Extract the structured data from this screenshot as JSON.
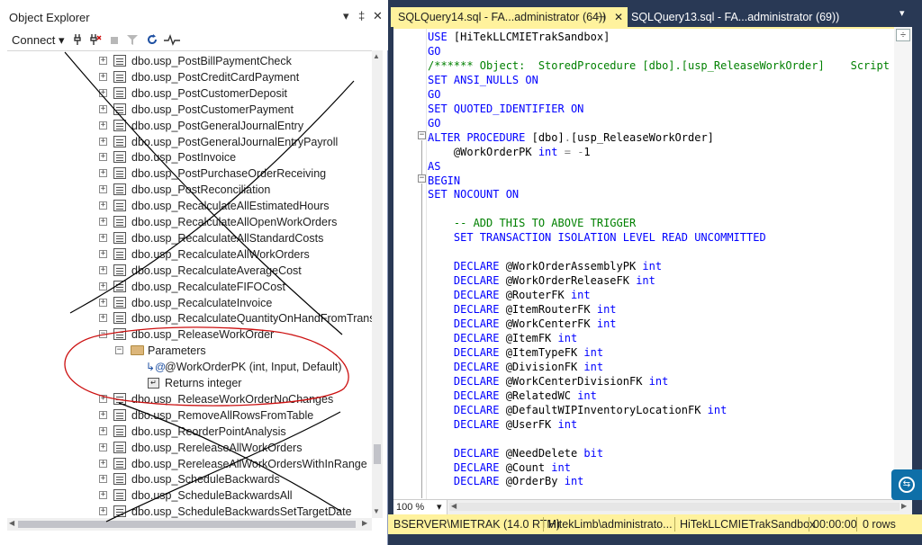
{
  "object_explorer": {
    "title": "Object Explorer",
    "pin_label": "▾",
    "autohide_label": "‡",
    "close_label": "✕",
    "connect_label": "Connect ▾",
    "tree": [
      {
        "kind": "proc",
        "label": "dbo.usp_PostBillPaymentCheck"
      },
      {
        "kind": "proc",
        "label": "dbo.usp_PostCreditCardPayment"
      },
      {
        "kind": "proc",
        "label": "dbo.usp_PostCustomerDeposit"
      },
      {
        "kind": "proc",
        "label": "dbo.usp_PostCustomerPayment"
      },
      {
        "kind": "proc",
        "label": "dbo.usp_PostGeneralJournalEntry"
      },
      {
        "kind": "proc",
        "label": "dbo.usp_PostGeneralJournalEntryPayroll"
      },
      {
        "kind": "proc",
        "label": "dbo.usp_PostInvoice"
      },
      {
        "kind": "proc",
        "label": "dbo.usp_PostPurchaseOrderReceiving"
      },
      {
        "kind": "proc",
        "label": "dbo.usp_PostReconciliation"
      },
      {
        "kind": "proc",
        "label": "dbo.usp_RecalculateAllEstimatedHours"
      },
      {
        "kind": "proc",
        "label": "dbo.usp_RecalculateAllOpenWorkOrders"
      },
      {
        "kind": "proc",
        "label": "dbo.usp_RecalculateAllStandardCosts"
      },
      {
        "kind": "proc",
        "label": "dbo.usp_RecalculateAllWorkOrders"
      },
      {
        "kind": "proc",
        "label": "dbo.usp_RecalculateAverageCost"
      },
      {
        "kind": "proc",
        "label": "dbo.usp_RecalculateFIFOCost"
      },
      {
        "kind": "proc",
        "label": "dbo.usp_RecalculateInvoice"
      },
      {
        "kind": "proc",
        "label": "dbo.usp_RecalculateQuantityOnHandFromTransac"
      },
      {
        "kind": "proc-open",
        "label": "dbo.usp_ReleaseWorkOrder"
      },
      {
        "kind": "folder",
        "label": "Parameters"
      },
      {
        "kind": "param",
        "label": "@WorkOrderPK (int, Input, Default)"
      },
      {
        "kind": "return",
        "label": "Returns integer"
      },
      {
        "kind": "proc",
        "label": "dbo.usp_ReleaseWorkOrderNoChanges"
      },
      {
        "kind": "proc",
        "label": "dbo.usp_RemoveAllRowsFromTable"
      },
      {
        "kind": "proc",
        "label": "dbo.usp_ReorderPointAnalysis"
      },
      {
        "kind": "proc",
        "label": "dbo.usp_RereleaseAllWorkOrders"
      },
      {
        "kind": "proc",
        "label": "dbo.usp_RereleaseAllWorkOrdersWithInRange"
      },
      {
        "kind": "proc",
        "label": "dbo.usp_ScheduleBackwards"
      },
      {
        "kind": "proc",
        "label": "dbo.usp_ScheduleBackwardsAll"
      },
      {
        "kind": "proc",
        "label": "dbo.usp_ScheduleBackwardsSetTargetDate"
      }
    ]
  },
  "tabs": [
    {
      "label": "SQLQuery14.sql - FA...administrator (64))",
      "pin": "⊣",
      "close": "✕",
      "active": true
    },
    {
      "label": "SQLQuery13.sql - FA...administrator (69))",
      "active": false
    }
  ],
  "tab_overflow": "▾",
  "editor": {
    "lines": [
      [
        [
          "kw",
          "USE "
        ],
        [
          "pl",
          "[HiTekLLCMIETrakSandbox]"
        ]
      ],
      [
        [
          "kw",
          "GO"
        ]
      ],
      [
        [
          "cm",
          "/****** Object:  StoredProcedure [dbo].[usp_ReleaseWorkOrder]    Script Date"
        ]
      ],
      [
        [
          "kw",
          "SET ANSI_NULLS ON"
        ]
      ],
      [
        [
          "kw",
          "GO"
        ]
      ],
      [
        [
          "kw",
          "SET QUOTED_IDENTIFIER ON"
        ]
      ],
      [
        [
          "kw",
          "GO"
        ]
      ],
      [
        [
          "kw",
          "ALTER PROCEDURE "
        ],
        [
          "pl",
          "[dbo]"
        ],
        [
          "gy",
          "."
        ],
        [
          "pl",
          "[usp_ReleaseWorkOrder]"
        ]
      ],
      [
        [
          "pl",
          "    @WorkOrderPK "
        ],
        [
          "kw",
          "int "
        ],
        [
          "gy",
          "= "
        ],
        [
          "gy",
          "-"
        ],
        [
          "pl",
          "1"
        ]
      ],
      [
        [
          "kw",
          "AS"
        ]
      ],
      [
        [
          "kw",
          "BEGIN"
        ]
      ],
      [
        [
          "kw",
          "SET NOCOUNT ON"
        ]
      ],
      [
        [
          "pl",
          ""
        ]
      ],
      [
        [
          "cm",
          "    -- ADD THIS TO ABOVE TRIGGER"
        ]
      ],
      [
        [
          "kw",
          "    SET TRANSACTION ISOLATION LEVEL READ UNCOMMITTED"
        ]
      ],
      [
        [
          "pl",
          ""
        ]
      ],
      [
        [
          "kw",
          "    DECLARE "
        ],
        [
          "pl",
          "@WorkOrderAssemblyPK "
        ],
        [
          "kw",
          "int"
        ]
      ],
      [
        [
          "kw",
          "    DECLARE "
        ],
        [
          "pl",
          "@WorkOrderReleaseFK "
        ],
        [
          "kw",
          "int"
        ]
      ],
      [
        [
          "kw",
          "    DECLARE "
        ],
        [
          "pl",
          "@RouterFK "
        ],
        [
          "kw",
          "int"
        ]
      ],
      [
        [
          "kw",
          "    DECLARE "
        ],
        [
          "pl",
          "@ItemRouterFK "
        ],
        [
          "kw",
          "int"
        ]
      ],
      [
        [
          "kw",
          "    DECLARE "
        ],
        [
          "pl",
          "@WorkCenterFK "
        ],
        [
          "kw",
          "int"
        ]
      ],
      [
        [
          "kw",
          "    DECLARE "
        ],
        [
          "pl",
          "@ItemFK "
        ],
        [
          "kw",
          "int"
        ]
      ],
      [
        [
          "kw",
          "    DECLARE "
        ],
        [
          "pl",
          "@ItemTypeFK "
        ],
        [
          "kw",
          "int"
        ]
      ],
      [
        [
          "kw",
          "    DECLARE "
        ],
        [
          "pl",
          "@DivisionFK "
        ],
        [
          "kw",
          "int"
        ]
      ],
      [
        [
          "kw",
          "    DECLARE "
        ],
        [
          "pl",
          "@WorkCenterDivisionFK "
        ],
        [
          "kw",
          "int"
        ]
      ],
      [
        [
          "kw",
          "    DECLARE "
        ],
        [
          "pl",
          "@RelatedWC "
        ],
        [
          "kw",
          "int"
        ]
      ],
      [
        [
          "kw",
          "    DECLARE "
        ],
        [
          "pl",
          "@DefaultWIPInventoryLocationFK "
        ],
        [
          "kw",
          "int"
        ]
      ],
      [
        [
          "kw",
          "    DECLARE "
        ],
        [
          "pl",
          "@UserFK "
        ],
        [
          "kw",
          "int"
        ]
      ],
      [
        [
          "pl",
          ""
        ]
      ],
      [
        [
          "kw",
          "    DECLARE "
        ],
        [
          "pl",
          "@NeedDelete "
        ],
        [
          "kw",
          "bit"
        ]
      ],
      [
        [
          "kw",
          "    DECLARE "
        ],
        [
          "pl",
          "@Count "
        ],
        [
          "kw",
          "int"
        ]
      ],
      [
        [
          "kw",
          "    DECLARE "
        ],
        [
          "pl",
          "@OrderBy "
        ],
        [
          "kw",
          "int"
        ]
      ]
    ],
    "zoom": "100 %",
    "zoom_caret": "▾"
  },
  "status": {
    "server": "BSERVER\\MIETRAK (14.0 RTM)",
    "user": "HitekLimb\\administrato...",
    "database": "HiTekLLCMIETrakSandbox",
    "elapsed": "00:00:00",
    "rows": "0 rows"
  },
  "colors": {
    "chrome": "#293955",
    "active_tab": "#fff29d",
    "status_bar": "#fff29d",
    "annotation_ink": "#000000",
    "annotation_circle": "#cc1010"
  }
}
